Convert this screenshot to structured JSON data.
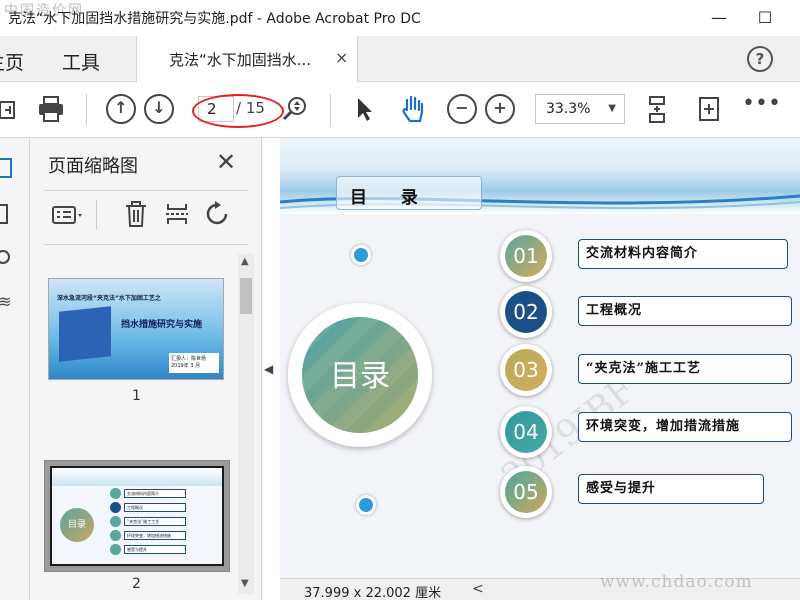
{
  "window": {
    "title": "克法“水下加固挡水措施研究与实施.pdf - Adobe Acrobat Pro DC",
    "watermark": "中国造价网",
    "minimize": "—",
    "maximize": "☐"
  },
  "tabs": {
    "home": "主页",
    "tools": "工具",
    "document": "克法“水下加固挡水...",
    "close": "×",
    "help": "?"
  },
  "toolbar": {
    "page_current": "2",
    "page_total": "/ 15",
    "zoom": "33.3%"
  },
  "thumbnails": {
    "title": "页面缩略图",
    "close": "✕",
    "pages": [
      {
        "number": "1",
        "line1": "深水急流河段“夹克法”水下加固工艺之",
        "line2": "挡水措施研究与实施",
        "reporter": "汇报人：陈世杨",
        "date": "2019年 3 月"
      },
      {
        "number": "2",
        "center": "目录",
        "items": [
          "交流材料内容简介",
          "工程概况",
          "“夹克法”施工工艺",
          "环境突变，增加措流措施",
          "感受与提升"
        ]
      }
    ]
  },
  "slide": {
    "header": "目 录",
    "center_label": "目录",
    "watermark": "2019JBF",
    "items": [
      {
        "num": "01",
        "text": "交流材料内容简介",
        "color": "#c7a85c"
      },
      {
        "num": "02",
        "text": "工程概况",
        "color": "#1c4f86"
      },
      {
        "num": "03",
        "text": "“夹克法”施工工艺",
        "color": "#b8ab5e"
      },
      {
        "num": "04",
        "text": "环境突变，增加措流措施",
        "color": "#3a9d9c"
      },
      {
        "num": "05",
        "text": "感受与提升",
        "color": "#c2a85b"
      }
    ]
  },
  "status": {
    "page_size": "37.999 x 22.002 厘米",
    "scroll_left": "<"
  },
  "bottom_watermark": "www.chdao.com"
}
